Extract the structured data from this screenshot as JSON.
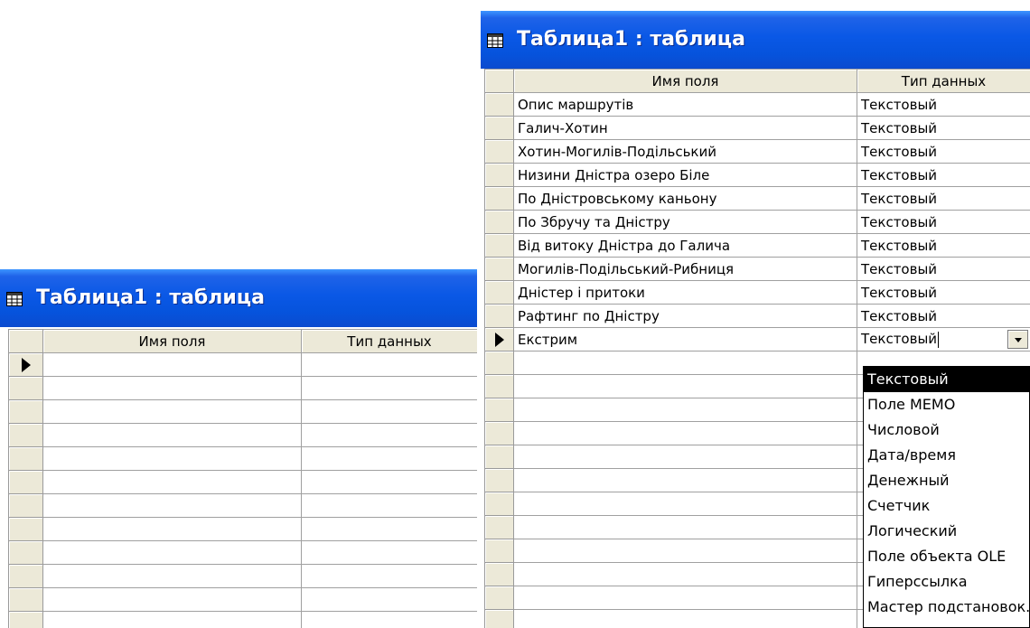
{
  "left_window": {
    "title": "Таблица1 : таблица",
    "columns": [
      "Имя поля",
      "Тип данных"
    ],
    "rows": [
      "",
      "",
      "",
      "",
      "",
      "",
      "",
      "",
      "",
      "",
      "",
      ""
    ]
  },
  "right_window": {
    "title": "Таблица1 : таблица",
    "columns": [
      "Имя поля",
      "Тип данных"
    ],
    "rows": [
      {
        "name": "Опис маршрутів",
        "type": "Текстовый"
      },
      {
        "name": "Галич-Хотин",
        "type": "Текстовый"
      },
      {
        "name": "Хотин-Могилів-Подільський",
        "type": "Текстовый"
      },
      {
        "name": "Низини Дністра озеро Біле",
        "type": "Текстовый"
      },
      {
        "name": "По Дністровському каньону",
        "type": "Текстовый"
      },
      {
        "name": "По Збручу та Дністру",
        "type": "Текстовый"
      },
      {
        "name": "Від витоку Дністра до Галича",
        "type": "Текстовый"
      },
      {
        "name": "Могилів-Подільський-Рибниця",
        "type": "Текстовый"
      },
      {
        "name": "Дністер і притоки",
        "type": "Текстовый"
      },
      {
        "name": "Рафтинг по Дністру",
        "type": "Текстовый"
      },
      {
        "name": "Екстрим",
        "type": "Текстовый"
      }
    ],
    "empty_rows": 12
  },
  "dropdown": {
    "selected": "Текстовый",
    "options": [
      "Текстовый",
      "Поле МЕМО",
      "Числовой",
      "Дата/время",
      "Денежный",
      "Счетчик",
      "Логический",
      "Поле объекта OLE",
      "Гиперссылка",
      "Мастер подстановок..."
    ]
  },
  "icons": {
    "table": "table-icon",
    "row_selector": "current-row-arrow-icon",
    "combo": "dropdown-arrow-icon"
  }
}
